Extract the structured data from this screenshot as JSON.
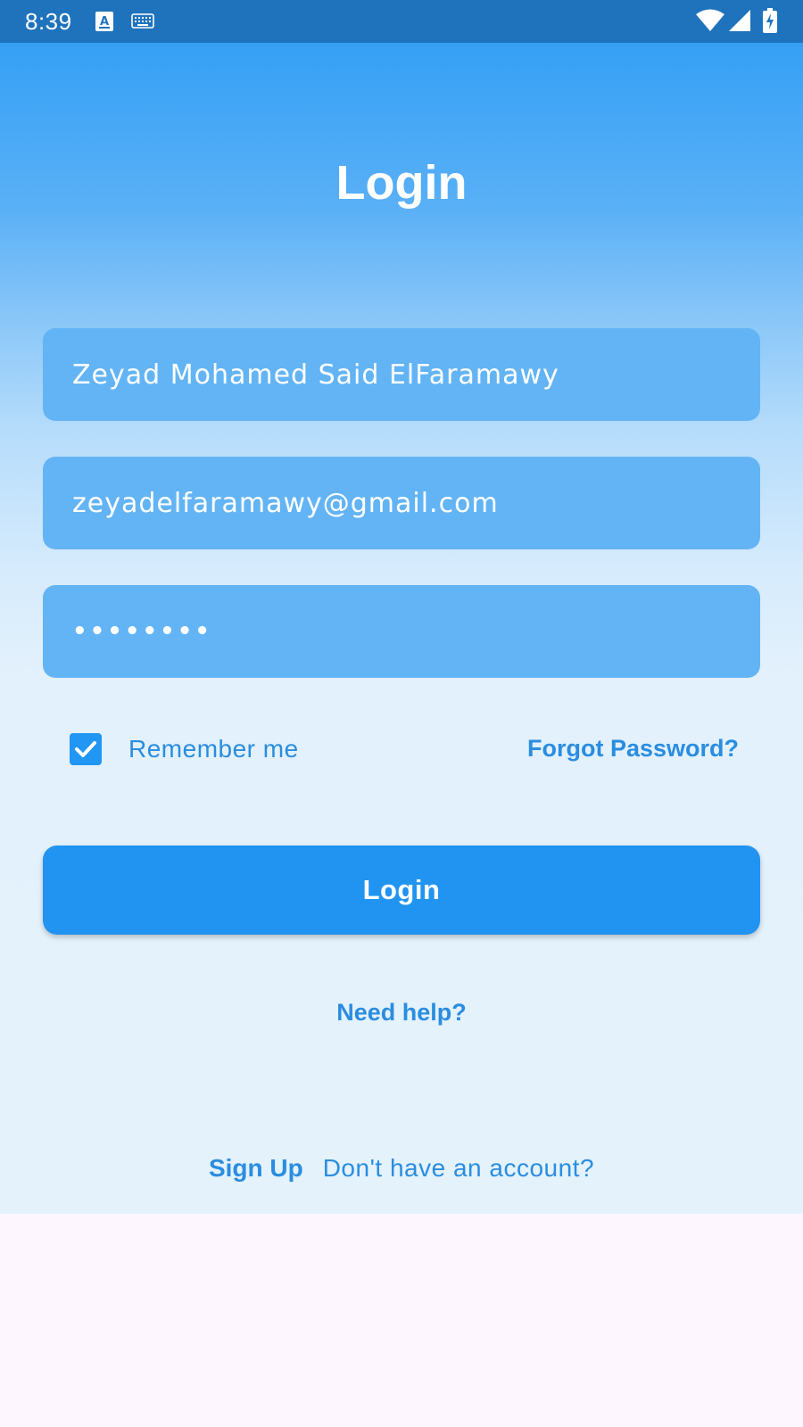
{
  "status_bar": {
    "time": "8:39",
    "icons": [
      "text-format-icon",
      "keyboard-icon",
      "wifi-icon",
      "cellular-signal-icon",
      "battery-charging-icon"
    ],
    "background_color": "#1f73bd"
  },
  "login_screen": {
    "title": "Login",
    "name_field": {
      "value": "Zeyad Mohamed Said ElFaramawy"
    },
    "email_field": {
      "value": "zeyadelfaramawy@gmail.com"
    },
    "password_field": {
      "value": "••••••••"
    },
    "remember_me": {
      "label": "Remember me",
      "checked": true
    },
    "forgot_password_label": "Forgot Password?",
    "login_button_label": "Login",
    "need_help_label": "Need help?",
    "sign_up_label": "Sign Up",
    "no_account_text": "Don't have an account?"
  },
  "colors": {
    "gradient_top": "#35a0f5",
    "gradient_bottom": "#e4f2fc",
    "field_background": "#63b4f5",
    "accent": "#2194f1",
    "link_text": "#2a8de0",
    "blank_area": "#fdf6fe"
  }
}
